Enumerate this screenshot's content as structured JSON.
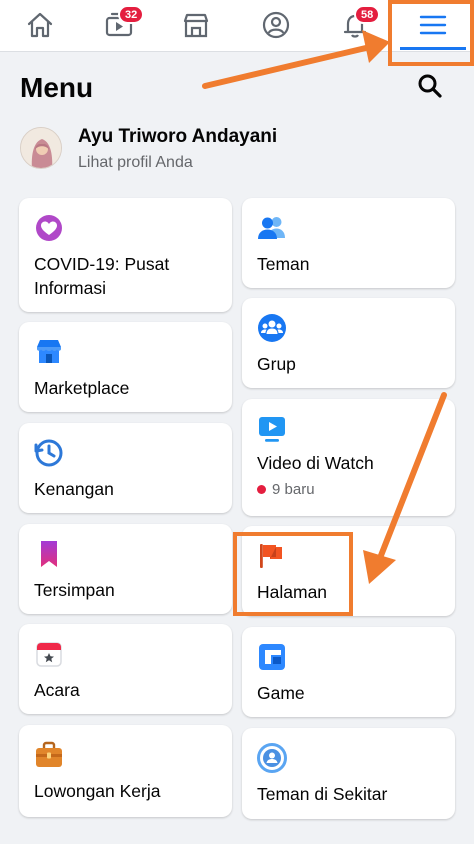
{
  "topnav": {
    "items": [
      {
        "name": "home-icon"
      },
      {
        "name": "watch-icon",
        "badge": "32"
      },
      {
        "name": "marketplace-icon"
      },
      {
        "name": "profile-icon"
      },
      {
        "name": "notifications-icon",
        "badge": "58"
      },
      {
        "name": "menu-icon"
      }
    ]
  },
  "header": {
    "title": "Menu"
  },
  "profile": {
    "name": "Ayu Triworo Andayani",
    "subtitle": "Lihat profil Anda"
  },
  "cards": {
    "covid": {
      "line1": "COVID-19: Pusat",
      "line2": "Informasi",
      "icon": "heart-icon"
    },
    "teman": {
      "label": "Teman",
      "icon": "friends-icon"
    },
    "marketplace": {
      "label": "Marketplace",
      "icon": "shop-icon"
    },
    "grup": {
      "label": "Grup",
      "icon": "groups-icon"
    },
    "kenangan": {
      "label": "Kenangan",
      "icon": "clock-icon"
    },
    "video": {
      "label": "Video di Watch",
      "sub": "9 baru",
      "icon": "video-icon"
    },
    "tersimpan": {
      "label": "Tersimpan",
      "icon": "bookmark-icon"
    },
    "halaman": {
      "label": "Halaman",
      "icon": "flag-icon"
    },
    "acara": {
      "label": "Acara",
      "icon": "calendar-icon"
    },
    "game": {
      "label": "Game",
      "icon": "game-icon"
    },
    "lowongan": {
      "label": "Lowongan Kerja",
      "icon": "briefcase-icon"
    },
    "sekitar": {
      "label": "Teman di Sekitar",
      "icon": "location-icon"
    }
  },
  "colors": {
    "accent": "#1877f2",
    "badge": "#e41e3f",
    "annotation": "#f07c2f"
  }
}
